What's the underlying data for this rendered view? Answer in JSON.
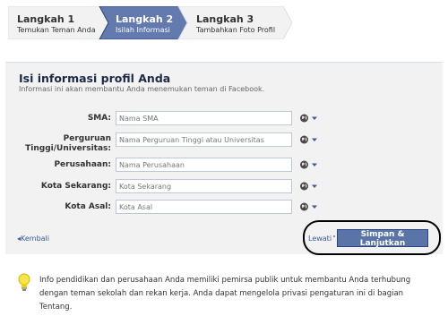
{
  "steps": [
    {
      "title": "Langkah 1",
      "subtitle": "Temukan Teman Anda"
    },
    {
      "title": "Langkah 2",
      "subtitle": "Isilah Informasi"
    },
    {
      "title": "Langkah 3",
      "subtitle": "Tambahkan Foto Profil"
    }
  ],
  "active_step": 2,
  "panel": {
    "title": "Isi informasi profil Anda",
    "description": "Informasi ini akan membantu Anda menemukan teman di Facebook."
  },
  "fields": [
    {
      "label": "SMA:",
      "placeholder": "Nama SMA"
    },
    {
      "label_line1": "Perguruan",
      "label_line2": "Tinggi/Universitas:",
      "placeholder": "Nama Perguruan Tinggi atau Universitas"
    },
    {
      "label": "Perusahaan:",
      "placeholder": "Nama Perusahaan"
    },
    {
      "label": "Kota Sekarang:",
      "placeholder": "Kota Sekarang"
    },
    {
      "label": "Kota Asal:",
      "placeholder": "Kota Asal"
    }
  ],
  "privacy_icon": "globe-icon",
  "actions": {
    "back": "Kembali",
    "skip": "Lewati",
    "save": "Simpan & Lanjutkan"
  },
  "info_text": "Info pendidikan dan perusahaan Anda memiliki pemirsa publik untuk membantu Anda terhubung dengan teman sekolah dan rekan kerja. Anda dapat mengelola privasi pengaturan ini di bagian Tentang.",
  "colors": {
    "active_step": "#627aad",
    "link": "#3b5998",
    "primary_button": "#5b74a8"
  }
}
